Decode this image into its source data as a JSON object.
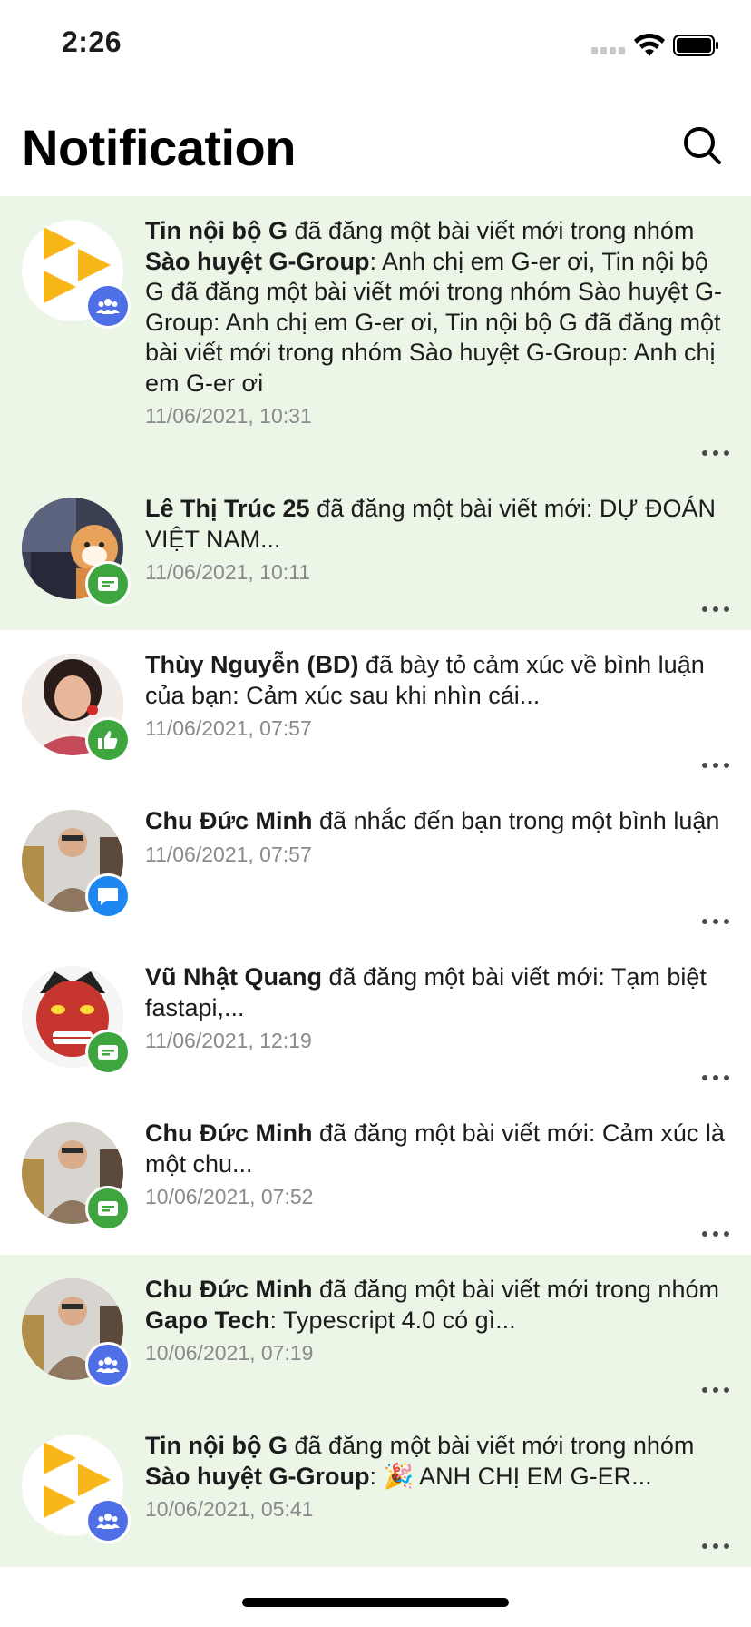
{
  "status_bar": {
    "time": "2:26"
  },
  "header": {
    "title": "Notification"
  },
  "colors": {
    "unread_bg": "#ecf6e6",
    "group_badge": "#4f6fe6",
    "post_badge": "#3fa63f",
    "comment_badge": "#1e88f0"
  },
  "notifications": [
    {
      "actor": "Tin nội bộ G",
      "parts": [
        " đã đăng một bài viết mới trong nhóm ",
        "Sào huyệt G-Group",
        ": Anh chị em G-er ơi, Tin nội bộ G đã đăng một bài viết mới trong nhóm Sào huyệt G-Group: Anh chị em G-er ơi, Tin nội bộ G đã đăng một bài viết mới trong nhóm Sào huyệt G-Group: Anh chị em G-er ơi"
      ],
      "time": "11/06/2021, 10:31",
      "avatar": "gapo-logo",
      "badge": "group-icon",
      "unread": true
    },
    {
      "actor": "Lê Thị Trúc 25",
      "parts": [
        " đã đăng một bài viết mới: DỰ ĐOÁN VIỆT NAM..."
      ],
      "time": "11/06/2021, 10:11",
      "avatar": "photo",
      "badge": "post-icon",
      "unread": true
    },
    {
      "actor": "Thùy Nguyễn (BD)",
      "parts": [
        " đã bày tỏ cảm xúc về bình luận của bạn: Cảm xúc sau khi nhìn cái..."
      ],
      "time": "11/06/2021, 07:57",
      "avatar": "photo",
      "badge": "like-icon",
      "unread": false
    },
    {
      "actor": "Chu Đức Minh",
      "parts": [
        " đã nhắc đến bạn trong một bình luận"
      ],
      "time": "11/06/2021, 07:57",
      "avatar": "photo",
      "badge": "comment-icon",
      "unread": false
    },
    {
      "actor": "Vũ Nhật Quang",
      "parts": [
        " đã đăng một bài viết mới: Tạm biệt fastapi,..."
      ],
      "time": "11/06/2021, 12:19",
      "avatar": "photo",
      "badge": "post-icon",
      "unread": false
    },
    {
      "actor": "Chu Đức Minh",
      "parts": [
        " đã đăng một bài viết mới: Cảm xúc là một chu..."
      ],
      "time": "10/06/2021, 07:52",
      "avatar": "photo",
      "badge": "post-icon",
      "unread": false
    },
    {
      "actor": "Chu Đức Minh",
      "parts": [
        " đã đăng một bài viết mới trong nhóm ",
        "Gapo Tech",
        ": Typescript 4.0 có gì..."
      ],
      "time": "10/06/2021, 07:19",
      "avatar": "photo",
      "badge": "group-icon",
      "unread": true
    },
    {
      "actor": "Tin nội bộ G",
      "parts": [
        " đã đăng một bài viết mới trong nhóm ",
        "Sào huyệt G-Group",
        ": 🎉 ANH CHỊ EM G-ER..."
      ],
      "time": "10/06/2021, 05:41",
      "avatar": "gapo-logo",
      "badge": "group-icon",
      "unread": true
    }
  ]
}
